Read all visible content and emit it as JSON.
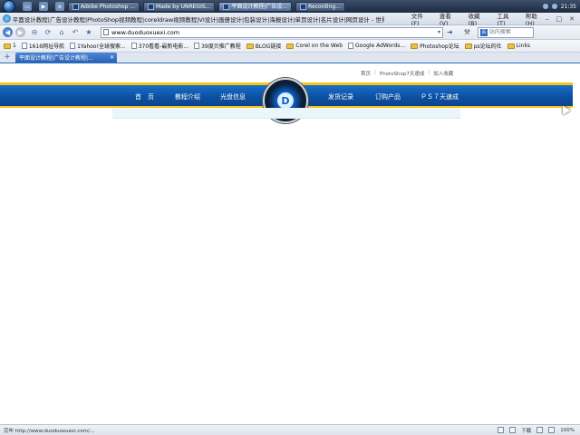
{
  "taskbar": {
    "tasks": [
      {
        "label": "Adobe Photoshop ..."
      },
      {
        "label": "Made by UNREGIS..."
      },
      {
        "label": "平面设计教程|广告设..."
      },
      {
        "label": "Recording..."
      }
    ],
    "clock": "21:35"
  },
  "window": {
    "title": "平面设计教程|广告设计教程|PhotoShop视频教程|coreldraw视频教程|VI设计|画册设计|包装设计|海报设计|单页设计|名片设计|网页设计 - 世界之窗 3.6",
    "menus": [
      "文件(F)",
      "查看(V)",
      "收藏(B)",
      "工具(T)",
      "帮助(H)"
    ]
  },
  "navbar": {
    "address": "www.duoduoxuexi.com",
    "search_placeholder": "站内搜索"
  },
  "bookmarks": [
    {
      "label": "1",
      "type": "folder"
    },
    {
      "label": "1616网址导航",
      "type": "page"
    },
    {
      "label": "1Yahoo!全球搜索...",
      "type": "page"
    },
    {
      "label": "370看看-最新电影...",
      "type": "page"
    },
    {
      "label": "39度贝推广教程",
      "type": "page"
    },
    {
      "label": "BLOG链接",
      "type": "folder"
    },
    {
      "label": "Corel on the Web",
      "type": "folder"
    },
    {
      "label": "Google AdWords...",
      "type": "page"
    },
    {
      "label": "Photoshop论坛",
      "type": "folder"
    },
    {
      "label": "ps论坛的社",
      "type": "folder"
    },
    {
      "label": "Links",
      "type": "folder"
    }
  ],
  "tabs": [
    {
      "label": "平面设计教程|广告设计教程|..."
    }
  ],
  "page": {
    "top_links": [
      "首页",
      "PhotoShop7天速成",
      "加入收藏"
    ],
    "nav": [
      "首　页",
      "教程介绍",
      "光盘信息",
      "发货记录",
      "订购产品",
      "ＰＳ７天速成"
    ],
    "logo_letter": "D"
  },
  "status": {
    "text": "完毕 http://www.duoduoxuexi.com/...",
    "download_label": "下载",
    "zoom": "100%"
  },
  "colors": {
    "banner": "#0b4f9f",
    "banner_accent": "#f5c518",
    "tab_active": "#2a62b3"
  }
}
